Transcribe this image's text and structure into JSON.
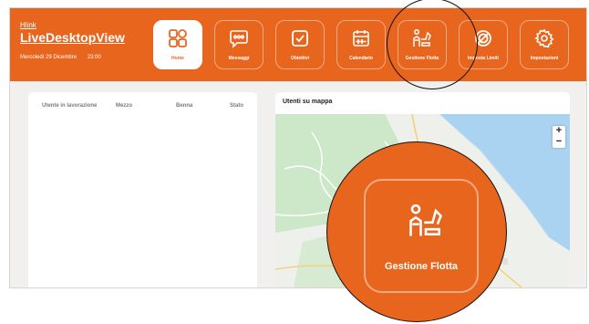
{
  "header": {
    "brand_small": "Hlink",
    "brand_name": "LiveDesktopView",
    "date": "Mercoledì 29 Dicembre",
    "time": "23:00"
  },
  "nav": {
    "items": [
      {
        "label": "Home",
        "icon": "home-grid-icon",
        "active": true
      },
      {
        "label": "Messaggi",
        "icon": "chat-icon",
        "active": false
      },
      {
        "label": "Obiettivi",
        "icon": "checkbox-icon",
        "active": false
      },
      {
        "label": "Calendario",
        "icon": "calendar-icon",
        "active": false
      },
      {
        "label": "Gestione Flotta",
        "icon": "excavator-worker-icon",
        "active": false
      },
      {
        "label": "Imposta Limiti",
        "icon": "no-entry-icon",
        "active": false
      },
      {
        "label": "Impostazioni",
        "icon": "gear-icon",
        "active": false
      }
    ]
  },
  "users_table": {
    "columns": [
      "Utente in lavorazione",
      "Mezzo",
      "Benna",
      "Stato"
    ],
    "rows": []
  },
  "map_panel": {
    "title": "Utenti su mappa",
    "zoom_in": "+",
    "zoom_out": "−"
  },
  "magnifier": {
    "label": "Gestione Flotta",
    "icon": "excavator-worker-icon"
  },
  "colors": {
    "brand_orange": "#e8651e",
    "map_land": "#eef0ec",
    "map_sea": "#a9d3f0",
    "map_green": "#cde8c9"
  }
}
